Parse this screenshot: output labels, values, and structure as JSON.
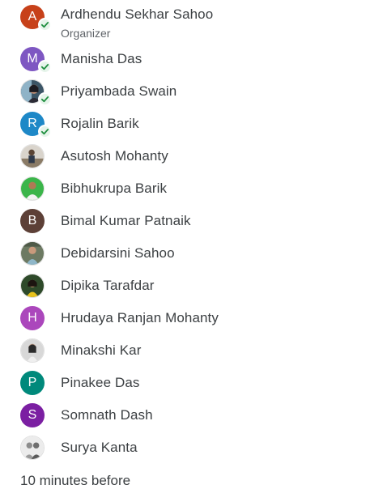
{
  "guests": [
    {
      "name": "Ardhendu Sekhar Sahoo",
      "role": "Organizer",
      "initial": "A",
      "avatar_color": "#c7411a",
      "accepted": true
    },
    {
      "name": "Manisha Das",
      "initial": "M",
      "avatar_color": "#7e57c2",
      "accepted": true
    },
    {
      "name": "Priyambada Swain",
      "avatar_type": "photo",
      "accepted": true
    },
    {
      "name": "Rojalin Barik",
      "initial": "R",
      "avatar_color": "#1e88c7",
      "accepted": true
    },
    {
      "name": "Asutosh Mohanty",
      "avatar_type": "photo",
      "accepted": false
    },
    {
      "name": "Bibhukrupa Barik",
      "avatar_type": "photo",
      "accepted": false
    },
    {
      "name": "Bimal Kumar Patnaik",
      "initial": "B",
      "avatar_color": "#5d4037",
      "accepted": false
    },
    {
      "name": "Debidarsini Sahoo",
      "avatar_type": "photo",
      "accepted": false
    },
    {
      "name": "Dipika Tarafdar",
      "avatar_type": "photo",
      "accepted": false
    },
    {
      "name": "Hrudaya Ranjan Mohanty",
      "initial": "H",
      "avatar_color": "#ab47bc",
      "accepted": false
    },
    {
      "name": "Minakshi Kar",
      "avatar_type": "photo",
      "accepted": false
    },
    {
      "name": "Pinakee Das",
      "initial": "P",
      "avatar_color": "#00897b",
      "accepted": false
    },
    {
      "name": "Somnath Dash",
      "initial": "S",
      "avatar_color": "#7b1fa2",
      "accepted": false
    },
    {
      "name": "Surya Kanta",
      "avatar_type": "photo",
      "accepted": false
    }
  ],
  "reminder": "10 minutes before",
  "colors": {
    "text": "#3c4043",
    "secondary": "#5f6368",
    "check": "#1e8e3e",
    "check_bg": "#e6f4ea"
  }
}
